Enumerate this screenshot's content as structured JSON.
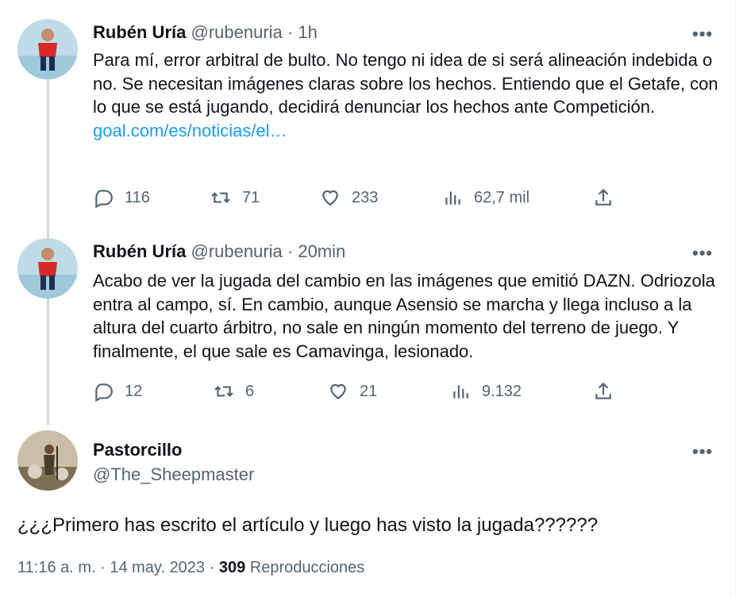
{
  "tweets": [
    {
      "name": "Rubén Uría",
      "handle": "@rubenuria",
      "time": "1h",
      "separator": " · ",
      "text": "Para mí, error arbitral de bulto. No tengo ni idea de si será alineación indebida o no. Se necesitan imágenes claras sobre los hechos. Entiendo que el Getafe, con lo que se está jugando, decidirá denunciar los hechos ante Competición.",
      "link": "goal.com/es/noticias/el…",
      "replies": "116",
      "retweets": "71",
      "likes": "233",
      "views": "62,7 mil"
    },
    {
      "name": "Rubén Uría",
      "handle": "@rubenuria",
      "time": "20min",
      "separator": " · ",
      "text": "Acabo de ver la jugada del cambio en las imágenes que emitió DAZN. Odriozola entra al campo, sí. En cambio, aunque Asensio se marcha y llega incluso a la altura del cuarto árbitro, no sale en ningún momento del terreno de juego. Y finalmente, el que sale es Camavinga, lesionado.",
      "replies": "12",
      "retweets": "6",
      "likes": "21",
      "views": "9.132"
    }
  ],
  "main": {
    "name": "Pastorcillo",
    "handle": "@The_Sheepmaster",
    "text": "¿¿¿Primero has escrito el artículo y luego has visto la jugada??????",
    "time": "11:16 a. m. · 14 may. 2023 · ",
    "views_count": "309",
    "views_label": " Reproducciones"
  },
  "more_glyph": "•••",
  "colors": {
    "link": "#1d9bf0",
    "secondary": "#536471",
    "thread": "#cfd9de"
  }
}
